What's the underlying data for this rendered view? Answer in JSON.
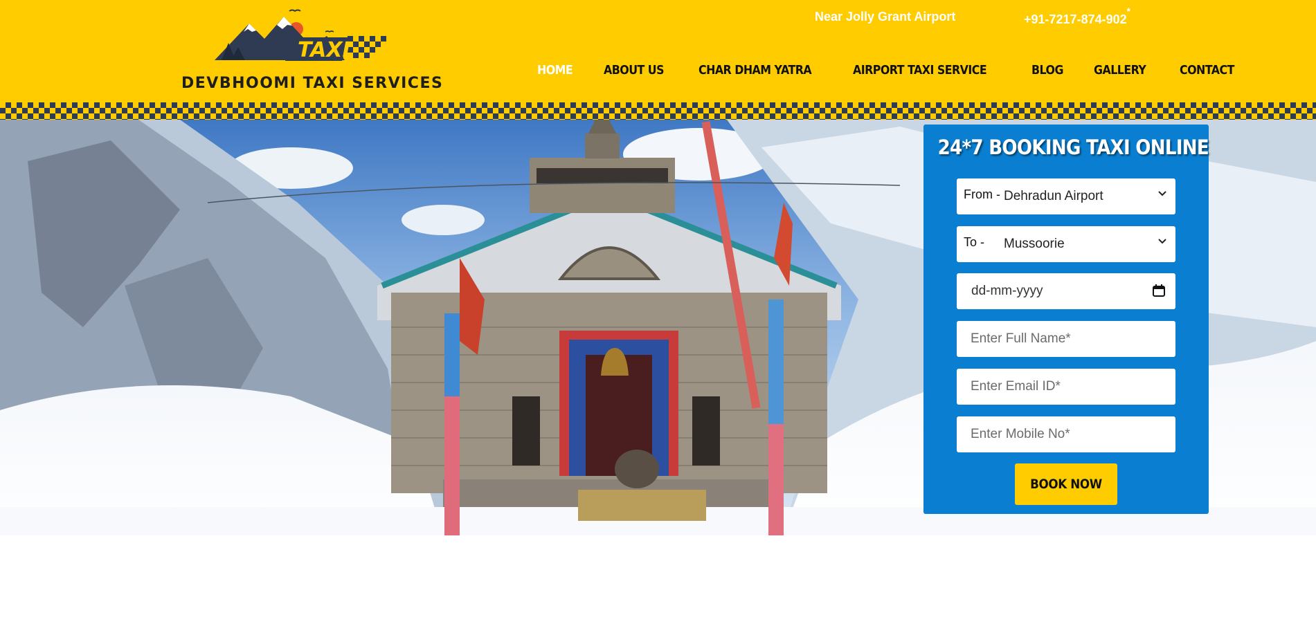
{
  "brand": {
    "logo_word": "TAXI",
    "name": "DEVBHOOMI TAXI SERVICES"
  },
  "topbar": {
    "location": "Near Jolly Grant Airport",
    "phone": "+91-7217-874-902",
    "phone_mark": "*"
  },
  "nav": {
    "items": [
      {
        "label": "HOME",
        "active": true
      },
      {
        "label": "ABOUT US",
        "active": false
      },
      {
        "label": "CHAR DHAM YATRA",
        "active": false
      },
      {
        "label": "AIRPORT TAXI SERVICE",
        "active": false
      },
      {
        "label": "BLOG",
        "active": false
      },
      {
        "label": "GALLERY",
        "active": false
      },
      {
        "label": "CONTACT",
        "active": false
      }
    ]
  },
  "booking": {
    "title": "24*7 BOOKING TAXI ONLINE",
    "from_prefix": "From -",
    "from_value": "Dehradun Airport",
    "to_prefix": "To -",
    "to_value": "Mussoorie",
    "date_placeholder": "dd-mm-yyyy",
    "name_placeholder": "Enter Full Name*",
    "email_placeholder": "Enter Email ID*",
    "mobile_placeholder": "Enter Mobile No*",
    "submit_label": "BOOK NOW"
  },
  "colors": {
    "brand_yellow": "#FFCC00",
    "form_blue": "#0A7FD1",
    "logo_dark": "#2f3b52"
  },
  "icons": [
    "mountain-logo-icon",
    "chevron-down-icon",
    "calendar-icon"
  ]
}
